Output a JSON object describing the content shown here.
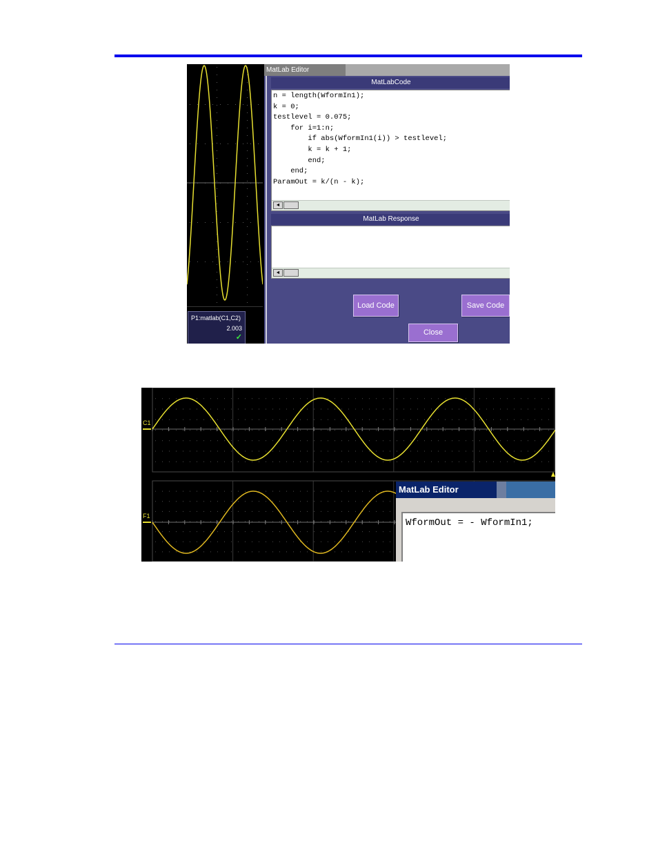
{
  "shot1": {
    "editor_title": "MatLab Editor",
    "code_header": "MatLabCode",
    "code_lines": [
      "n = length(WformIn1);",
      "k = 0;",
      "testlevel = 0.075;",
      "    for i=1:n;",
      "        if abs(WformIn1(i)) > testlevel;",
      "        k = k + 1;",
      "        end;",
      "    end;",
      "ParamOut = k/(n - k);"
    ],
    "response_header": "MatLab Response",
    "buttons": {
      "load": "Load Code",
      "save": "Save Code",
      "close": "Close"
    },
    "param": {
      "name": "P1:matlab(C1,C2)",
      "value": "2.003",
      "status_icon": "check-icon"
    },
    "colors": {
      "trace": "#e8e030",
      "panel": "#4a4a86",
      "button": "#9a6fd0"
    }
  },
  "shot2": {
    "channel_top": "C1",
    "channel_bottom": "F1",
    "editor_title": "MatLab Editor",
    "code": "WformOut = - WformIn1;",
    "colors": {
      "trace_top": "#e8e030",
      "trace_bottom": "#e0b820"
    }
  },
  "scrollbar_arrow": "◄"
}
